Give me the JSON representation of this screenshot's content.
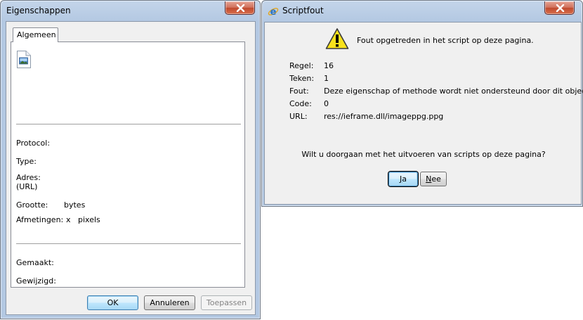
{
  "properties_window": {
    "title": "Eigenschappen",
    "tab_label": "Algemeen",
    "fields": {
      "protocol_label": "Protocol:",
      "type_label": "Type:",
      "address_label": "Adres:",
      "address_sub_label": "(URL)",
      "size_label": "Grootte:",
      "size_unit": "bytes",
      "dimensions_label": "Afmetingen:",
      "dimensions_separator": "x",
      "dimensions_unit": "pixels",
      "created_label": "Gemaakt:",
      "modified_label": "Gewijzigd:"
    },
    "buttons": {
      "ok": "OK",
      "cancel": "Annuleren",
      "apply": "Toepassen"
    }
  },
  "script_error_window": {
    "title": "Scriptfout",
    "message": "Fout opgetreden in het script op deze pagina.",
    "details": {
      "line_label": "Regel:",
      "line_value": "16",
      "char_label": "Teken:",
      "char_value": "1",
      "error_label": "Fout:",
      "error_value": "Deze eigenschap of methode wordt niet ondersteund door dit object",
      "code_label": "Code:",
      "code_value": "0",
      "url_label": "URL:",
      "url_value": "res://ieframe.dll/imageppg.ppg"
    },
    "question": "Wilt u doorgaan met het uitvoeren van scripts op deze pagina?",
    "buttons": {
      "yes_mnemonic": "J",
      "yes_rest": "a",
      "no_mnemonic": "N",
      "no_rest": "ee"
    }
  },
  "icons": {
    "close": "close-icon",
    "file": "image-file-icon",
    "warning": "warning-icon",
    "ie": "internet-explorer-icon"
  },
  "colors": {
    "window_frame": "#b3c8e2",
    "client_bg": "#f0f0f0",
    "close_button": "#c04a2f",
    "default_button_border": "#3c7fb1",
    "warning_yellow": "#f9e21b"
  }
}
